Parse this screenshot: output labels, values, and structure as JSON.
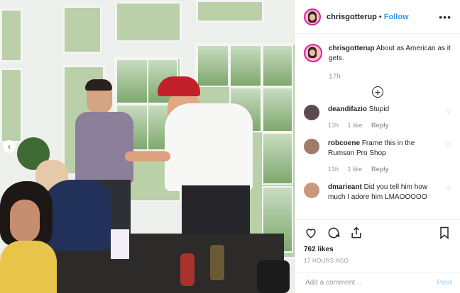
{
  "post": {
    "username": "chrisgotterup",
    "follow_label": "Follow",
    "more_icon": "more-icon",
    "caption_text": "About as American as it gets.",
    "caption_time": "17h",
    "load_more_icon": "plus-circle-icon",
    "comments": [
      {
        "username": "deandifazio",
        "text": "Stupid",
        "time": "13h",
        "likes": "1 like",
        "reply": "Reply",
        "avatar_color": "#5b4a52"
      },
      {
        "username": "robcoene",
        "text": "Frame this in the Rumson Pro Shop",
        "time": "13h",
        "likes": "1 like",
        "reply": "Reply",
        "avatar_color": "#a07a6a"
      },
      {
        "username": "dmarieant",
        "text": "Did you tell him how much I adore him LMAOOOOO",
        "time": "",
        "likes": "",
        "reply": "",
        "avatar_color": "#c8987a"
      }
    ],
    "likes": "762 likes",
    "timestamp": "17 HOURS AGO",
    "comment_placeholder": "Add a comment…",
    "post_label": "Post",
    "photo_nav": "‹"
  },
  "colors": {
    "link": "#3897f0",
    "muted": "#999999",
    "post_disabled": "#b2dffc"
  }
}
